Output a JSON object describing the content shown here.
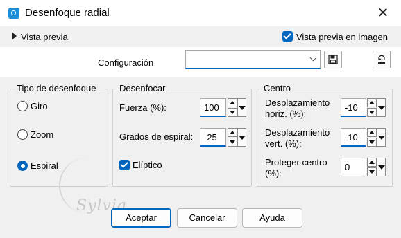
{
  "window": {
    "title": "Desenfoque radial",
    "close_label": "✕"
  },
  "preview": {
    "expand_label": "Vista previa",
    "checkbox_label": "Vista previa en imagen",
    "checked": true
  },
  "config": {
    "label": "Configuración",
    "value": "",
    "save_icon": "save-icon",
    "reset_icon": "reset-icon"
  },
  "blur_type": {
    "title": "Tipo de desenfoque",
    "options": [
      {
        "label": "Giro",
        "checked": false
      },
      {
        "label": "Zoom",
        "checked": false
      },
      {
        "label": "Espiral",
        "checked": true
      }
    ]
  },
  "blur": {
    "title": "Desenfocar",
    "strength": {
      "label": "Fuerza (%):",
      "value": "100"
    },
    "spiral": {
      "label": "Grados de espiral:",
      "value": "-25"
    },
    "elliptic": {
      "label": "Elíptico",
      "checked": true
    }
  },
  "center": {
    "title": "Centro",
    "h_offset": {
      "label_line1": "Desplazamiento",
      "label_line2": "horiz. (%):",
      "value": "-10"
    },
    "v_offset": {
      "label_line1": "Desplazamiento",
      "label_line2": "vert. (%):",
      "value": "-10"
    },
    "protect": {
      "label_line1": "Proteger centro",
      "label_line2": "(%):",
      "value": "0"
    }
  },
  "buttons": {
    "ok": "Aceptar",
    "cancel": "Cancelar",
    "help": "Ayuda"
  },
  "watermark": "Sylvia",
  "colors": {
    "accent": "#0067c0",
    "background": "#f0f0f0"
  }
}
